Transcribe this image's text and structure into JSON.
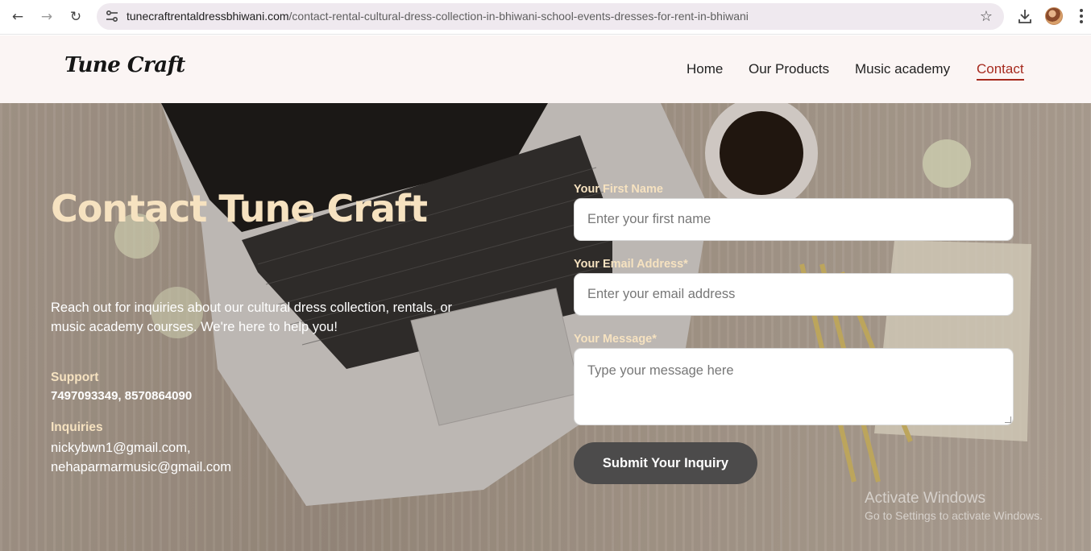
{
  "browser": {
    "url_host": "tunecraftrentaldressbhiwani.com",
    "url_path": "/contact-rental-cultural-dress-collection-in-bhiwani-school-events-dresses-for-rent-in-bhiwani",
    "icons": [
      "back-arrow-icon",
      "forward-arrow-icon",
      "reload-icon",
      "site-info-icon",
      "star-icon",
      "download-icon",
      "avatar",
      "kebab-menu-icon"
    ]
  },
  "header": {
    "logo": "Tune Craft",
    "nav": {
      "home": "Home",
      "products": "Our Products",
      "academy": "Music academy",
      "contact": "Contact"
    },
    "active_color": "#a62a1e"
  },
  "hero": {
    "title": "Contact Tune Craft",
    "description": "Reach out for inquiries about our cultural dress collection, rentals, or music academy courses. We're here to help you!",
    "support_heading": "Support",
    "support_value": "7497093349, 8570864090",
    "inquiries_heading": "Inquiries",
    "inquiries_line1": "nickybwn1@gmail.com,",
    "inquiries_line2": "nehaparmarmusic@gmail.com",
    "accent_color": "#f6e2c0"
  },
  "form": {
    "first_name_label": "Your First Name",
    "first_name_placeholder": "Enter your first name",
    "email_label": "Your Email Address*",
    "email_placeholder": "Enter your email address",
    "message_label": "Your Message*",
    "message_placeholder": "Type your message here",
    "submit_label": "Submit Your Inquiry"
  },
  "watermark": {
    "line1": "Activate Windows",
    "line2": "Go to Settings to activate Windows."
  }
}
